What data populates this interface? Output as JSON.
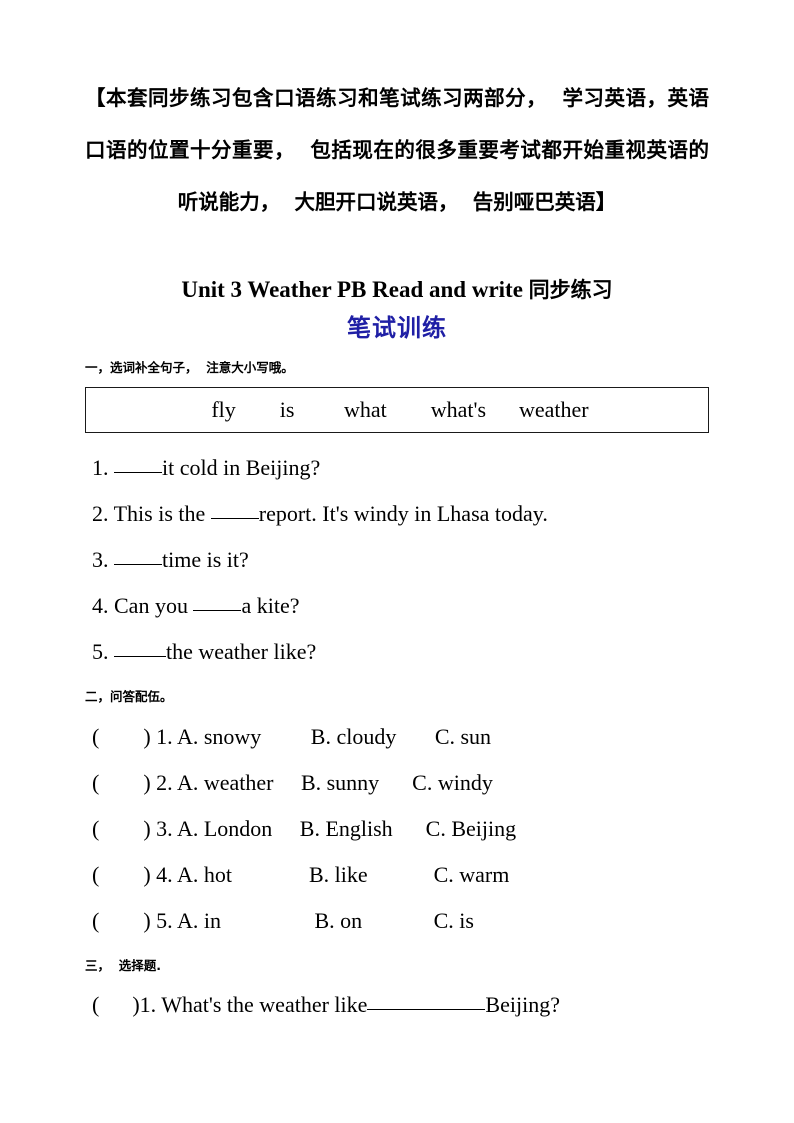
{
  "document": {
    "intro": "【本套同步练习包含口语练习和笔试练习两部分，  学习英语，英语口语的位置十分重要，  包括现在的很多重要考试都开始重视英语的听说能力，  大胆开口说英语，  告别哑巴英语】",
    "title_en": "Unit 3 Weather PB Read and write ",
    "title_cn": "同步练习",
    "subtitle": "笔试训练",
    "subtitle_color": "#1f1fa5"
  },
  "section_one": {
    "heading": "一，选词补全句子，  注意大小写哦。",
    "word_bank": [
      "fly",
      "is",
      "what",
      "what's",
      "weather"
    ],
    "word_bank_line": "fly        is         what        what's      weather",
    "questions": [
      {
        "number": "1.",
        "before": " ",
        "blank": "b-48",
        "after": "it cold in Beijing?"
      },
      {
        "number": "2.",
        "before": " This is the ",
        "blank": "b-48",
        "after": "report. It's windy in Lhasa today."
      },
      {
        "number": "3.",
        "before": " ",
        "blank": "b-48",
        "after": "time is it?"
      },
      {
        "number": "4.",
        "before": " Can you ",
        "blank": "b-48",
        "after": "a kite?"
      },
      {
        "number": "5.",
        "before": " ",
        "blank": "b-52",
        "after": "the weather like?"
      }
    ]
  },
  "section_two": {
    "heading": "二，问答配伍。",
    "items": [
      "(        ) 1. A. snowy         B. cloudy       C. sun",
      "(        ) 2. A. weather     B. sunny      C. windy",
      "(        ) 3. A. London     B. English      C. Beijing",
      "(        ) 4. A. hot              B. like            C. warm",
      "(        ) 5. A. in                 B. on             C. is"
    ]
  },
  "section_three": {
    "heading": "三，  选择题.",
    "items": [
      {
        "prefix": "(      )1. What's the weather like",
        "blank": "b-118",
        "suffix": "Beijing?"
      }
    ]
  }
}
